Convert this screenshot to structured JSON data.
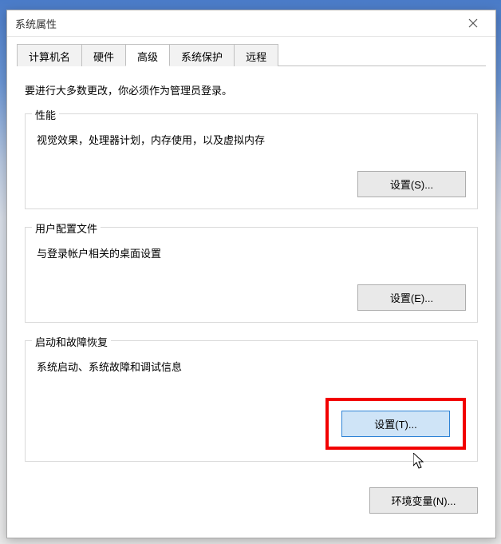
{
  "window": {
    "title": "系统属性"
  },
  "tabs": {
    "items": [
      "计算机名",
      "硬件",
      "高级",
      "系统保护",
      "远程"
    ],
    "active_index": 2
  },
  "instruction": "要进行大多数更改，你必须作为管理员登录。",
  "groups": {
    "performance": {
      "legend": "性能",
      "desc": "视觉效果，处理器计划，内存使用，以及虚拟内存",
      "button": "设置(S)..."
    },
    "userprofile": {
      "legend": "用户配置文件",
      "desc": "与登录帐户相关的桌面设置",
      "button": "设置(E)..."
    },
    "startup": {
      "legend": "启动和故障恢复",
      "desc": "系统启动、系统故障和调试信息",
      "button": "设置(T)..."
    }
  },
  "footer": {
    "env_button": "环境变量(N)..."
  }
}
